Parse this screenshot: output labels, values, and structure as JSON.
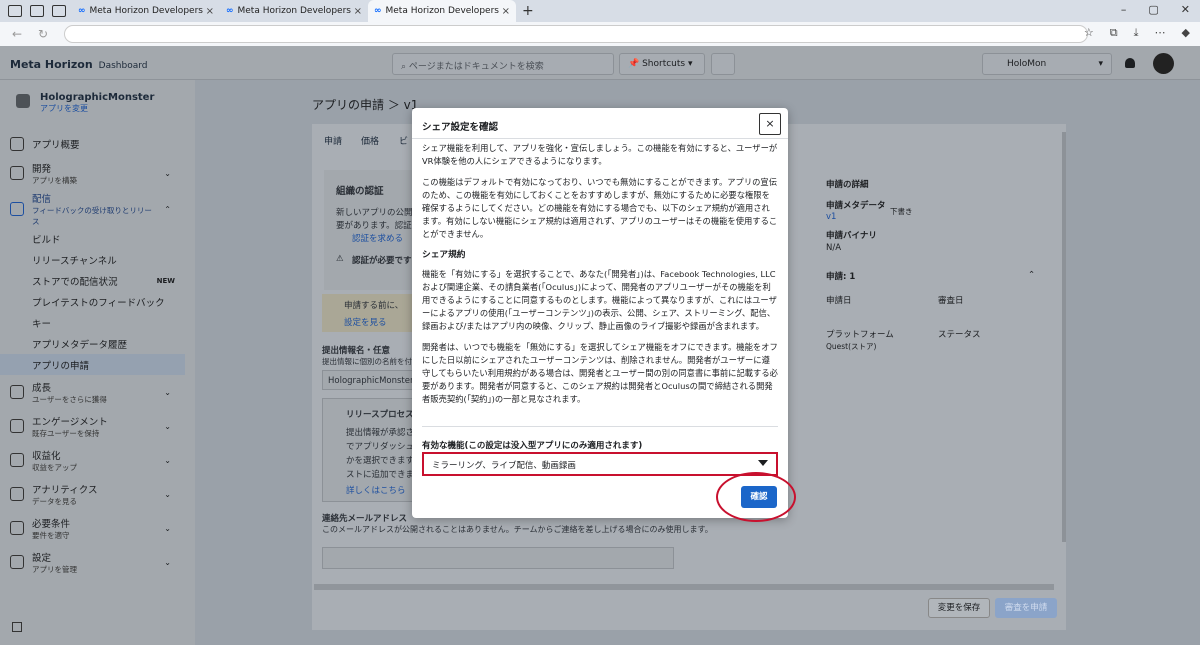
{
  "browser": {
    "tabs": [
      {
        "label": "Meta Horizon Developers"
      },
      {
        "label": "Meta Horizon Developers"
      },
      {
        "label": "Meta Horizon Developers"
      }
    ]
  },
  "header": {
    "logo": "Meta Horizon",
    "logo_sub": "Dashboard",
    "search_placeholder": "ページまたはドキュメントを検索",
    "shortcuts": "Shortcuts",
    "org": "HoloMon"
  },
  "app": {
    "name": "HolographicMonster",
    "change": "アプリを変更"
  },
  "sidebar": {
    "items": [
      {
        "label": "アプリ概要",
        "sub": ""
      },
      {
        "label": "開発",
        "sub": "アプリを構築"
      },
      {
        "label": "配信",
        "sub": "フィードバックの受け取りとリリース"
      },
      {
        "label": "ビルド"
      },
      {
        "label": "リリースチャンネル"
      },
      {
        "label": "ストアでの配信状況",
        "badge": "NEW"
      },
      {
        "label": "プレイテストのフィードバック"
      },
      {
        "label": "キー"
      },
      {
        "label": "アプリメタデータ履歴"
      },
      {
        "label": "アプリの申請"
      },
      {
        "label": "成長",
        "sub": "ユーザーをさらに獲得"
      },
      {
        "label": "エンゲージメント",
        "sub": "既存ユーザーを保持"
      },
      {
        "label": "収益化",
        "sub": "収益をアップ"
      },
      {
        "label": "アナリティクス",
        "sub": "データを見る"
      },
      {
        "label": "必要条件",
        "sub": "要件を適守"
      },
      {
        "label": "設定",
        "sub": "アプリを管理"
      }
    ]
  },
  "main": {
    "title": "アプリの申請 ＞ v1",
    "tabs": [
      "申請",
      "価格",
      "ビ"
    ],
    "section_title": "組織の認証",
    "section_text": "新しいアプリの公開",
    "section_text2": "要があります。認証",
    "link1": "認証を求める",
    "warn": "認証が必要です",
    "notice": "申請する前に、",
    "notice_link": "設定を見る",
    "submit_name_label": "提出情報名・任意",
    "submit_name_hint": "提出情報に個別の名前を付",
    "submit_name_value": "HolographicMonster(",
    "release_title": "リリースプロセス",
    "release_lines": [
      "提出情報が承認さ",
      "でアプリダッシュ",
      "かを選択できます",
      "ストに追加できま"
    ],
    "release_link": "詳しくはこちら",
    "email_label": "連絡先メールアドレス",
    "email_hint": "このメールアドレスが公開されることはありません。チームからご連絡を差し上げる場合にのみ使用します。",
    "save_button": "変更を保存",
    "submit_button": "審査を申請"
  },
  "details": {
    "title": "申請の詳細",
    "metadata_label": "申請メタデータ",
    "metadata_value": "v1",
    "draft": "下書き",
    "binary_label": "申請バイナリ",
    "binary_value": "N/A",
    "app_label": "申請: 1",
    "date_label": "申請日",
    "review_label": "審査日",
    "platform_label": "プラットフォーム",
    "platform_value": "Quest(ストア)",
    "status_label": "ステータス"
  },
  "modal": {
    "title": "シェア設定を確認",
    "close": "×",
    "p1": "シェア機能を利用して、アプリを強化・宣伝しましょう。この機能を有効にすると、ユーザーがVR体験を他の人にシェアできるようになります。",
    "p2": "この機能はデフォルトで有効になっており、いつでも無効にすることができます。アプリの宣伝のため、この機能を有効にしておくことをおすすめしますが、無効にするために必要な権限を確保するようにしてください。どの機能を有効にする場合でも、以下のシェア規約が適用されます。有効にしない機能にシェア規約は適用されず、アプリのユーザーはその機能を使用することができません。",
    "terms_heading": "シェア規約",
    "p3": "機能を「有効にする」を選択することで、あなた(「開発者」)は、Facebook Technologies, LLCおよび関連企業、その請負業者(「Oculus」)によって、開発者のアプリユーザーがその機能を利用できるようにすることに同意するものとします。機能によって異なりますが、これにはユーザーによるアプリの使用(「ユーザーコンテンツ」)の表示、公開、シェア、ストリーミング、配信、録画および/またはアプリ内の映像、クリップ、静止画像のライブ撮影や録画が含まれます。",
    "p4": "開発者は、いつでも機能を「無効にする」を選択してシェア機能をオフにできます。機能をオフにした日以前にシェアされたユーザーコンテンツは、削除されません。開発者がユーザーに遵守してもらいたい利用規約がある場合は、開発者とユーザー間の別の同意書に事前に記載する必要があります。開発者が同意すると、このシェア規約は開発者とOculusの間で締結される開発者販売契約(「契約」)の一部と見なされます。",
    "features_label": "有効な機能(この設定は没入型アプリにのみ適用されます)",
    "features_value": "ミラーリング、ライブ配信、動画録画",
    "confirm": "確認"
  }
}
